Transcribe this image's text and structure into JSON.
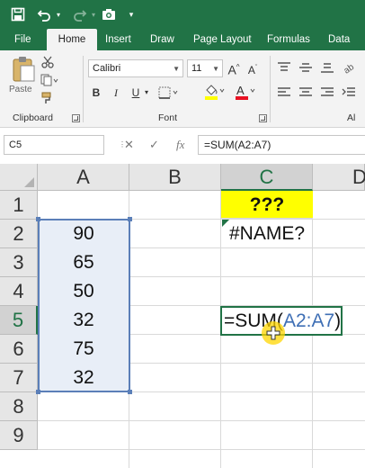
{
  "quick_access": {
    "icons": [
      "save-icon",
      "undo-icon",
      "redo-icon",
      "camera-icon",
      "customize-icon"
    ]
  },
  "ribbon_tabs": [
    "File",
    "Home",
    "Insert",
    "Draw",
    "Page Layout",
    "Formulas",
    "Data"
  ],
  "active_tab": "Home",
  "ribbon": {
    "paste_label": "Paste",
    "clipboard_label": "Clipboard",
    "font_label": "Font",
    "font_name": "Calibri",
    "font_size": "11",
    "align_label_partial": "Al",
    "bold": "B",
    "italic": "I",
    "underline": "U"
  },
  "formula_bar": {
    "name_box": "C5",
    "cancel_glyph": "✕",
    "enter_glyph": "✓",
    "fx_glyph": "fx",
    "formula": "=SUM(A2:A7)"
  },
  "grid": {
    "columns": [
      "A",
      "B",
      "C",
      "D"
    ],
    "rows": [
      "1",
      "2",
      "3",
      "4",
      "5",
      "6",
      "7",
      "8",
      "9"
    ],
    "selected_column": "C",
    "selected_row": "5",
    "column_a_values": [
      "90",
      "65",
      "50",
      "32",
      "75",
      "32"
    ],
    "c1": "???",
    "c2": "#NAME?",
    "c5_prefix": "=SUM(",
    "c5_ref": "A2:A7",
    "c5_suffix": ")"
  },
  "colors": {
    "excel_green": "#217346",
    "highlight_yellow": "#ffff00",
    "range_blue": "#5b7fb8",
    "reference_text_blue": "#3f6fb5"
  }
}
